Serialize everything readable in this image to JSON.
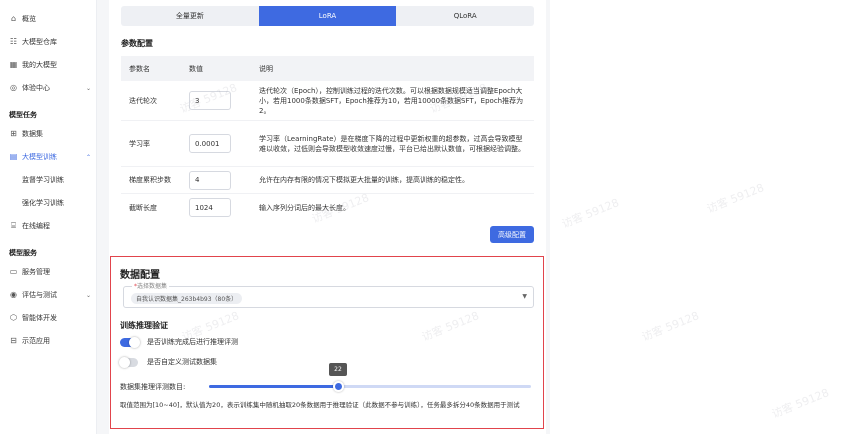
{
  "sidebar": {
    "items": [
      {
        "label": "概览",
        "icon": "home-icon"
      },
      {
        "label": "大模型仓库",
        "icon": "list-icon"
      },
      {
        "label": "我的大模型",
        "icon": "grid-icon"
      },
      {
        "label": "体验中心",
        "icon": "compass-icon"
      }
    ],
    "group_tasks": "模型任务",
    "task_items": [
      {
        "label": "数据集"
      },
      {
        "label": "大模型训练"
      },
      {
        "label": "监督学习训练"
      },
      {
        "label": "强化学习训练"
      },
      {
        "label": "在线编程"
      }
    ],
    "group_services": "模型服务",
    "service_items": [
      {
        "label": "服务管理"
      },
      {
        "label": "评估与测试"
      },
      {
        "label": "智能体开发"
      },
      {
        "label": "示范应用"
      }
    ]
  },
  "tabs": [
    "全量更新",
    "LoRA",
    "QLoRA"
  ],
  "active_tab": "LoRA",
  "param_section_title": "参数配置",
  "param_table": {
    "headers": [
      "参数名",
      "数值",
      "说明"
    ],
    "rows": [
      {
        "name": "迭代轮次",
        "value": "3",
        "desc": "迭代轮次（Epoch），控制训练过程的迭代次数。可以根据数据规模适当调整Epoch大小，若用1000条数据SFT，Epoch推荐为10，若用10000条数据SFT，Epoch推荐为2。"
      },
      {
        "name": "学习率",
        "value": "0.0001",
        "desc": "学习率（LearningRate）是在梯度下降的过程中更新权重的超参数，过高会导致模型难以收敛，过低则会导致模型收敛速度过慢，平台已给出默认数值，可根据经验调整。"
      },
      {
        "name": "梯度累积步数",
        "value": "4",
        "desc": "允许在内存有限的情况下模拟更大批量的训练，提高训练的稳定性。"
      },
      {
        "name": "截断长度",
        "value": "1024",
        "desc": "输入序列分词后的最大长度。"
      }
    ]
  },
  "advanced_button": "高级配置",
  "data_config": {
    "title": "数据配置",
    "select_label": "选择数据集",
    "selected_dataset": "自我认识数据集_263b4b93（80条）",
    "validation_title": "训练推理验证",
    "toggle_eval": "是否训练完成后进行推理评测",
    "toggle_custom": "是否自定义测试数据集",
    "slider_label": "数据集推理评测数目:",
    "slider_value": 22,
    "slider_min": 10,
    "slider_max": 40,
    "hint": "取值范围为[10~40]，默认值为20，表示训练集中随机抽取20条数据用于推理验证（此数据不参与训练），任务最多拆分40条数据用于测试"
  },
  "watermark": "访客 59128",
  "colors": {
    "accent": "#3e6ae1",
    "highlight_border": "#e1444c"
  }
}
